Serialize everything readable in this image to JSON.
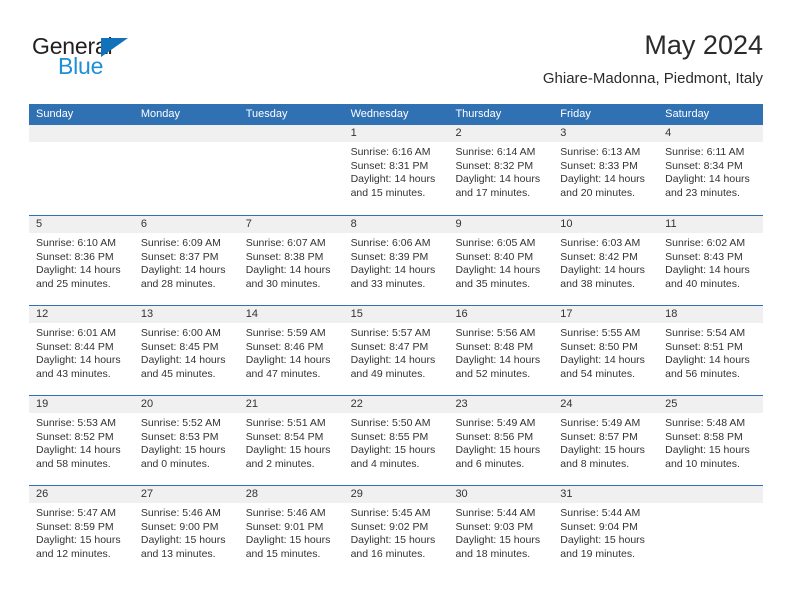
{
  "brand": {
    "name_part1": "General",
    "name_part2": "Blue",
    "triangle_color": "#1271bb",
    "blue_color": "#1f8fd6"
  },
  "header": {
    "month_title": "May 2024",
    "location": "Ghiare-Madonna, Piedmont, Italy"
  },
  "theme": {
    "header_blue": "#3071b4",
    "day_band_gray": "#f0f0f0",
    "text_color": "#333333"
  },
  "weekday_headers": [
    "Sunday",
    "Monday",
    "Tuesday",
    "Wednesday",
    "Thursday",
    "Friday",
    "Saturday"
  ],
  "weeks": [
    [
      {
        "day": "",
        "lines": []
      },
      {
        "day": "",
        "lines": []
      },
      {
        "day": "",
        "lines": []
      },
      {
        "day": "1",
        "lines": [
          "Sunrise: 6:16 AM",
          "Sunset: 8:31 PM",
          "Daylight: 14 hours",
          "and 15 minutes."
        ]
      },
      {
        "day": "2",
        "lines": [
          "Sunrise: 6:14 AM",
          "Sunset: 8:32 PM",
          "Daylight: 14 hours",
          "and 17 minutes."
        ]
      },
      {
        "day": "3",
        "lines": [
          "Sunrise: 6:13 AM",
          "Sunset: 8:33 PM",
          "Daylight: 14 hours",
          "and 20 minutes."
        ]
      },
      {
        "day": "4",
        "lines": [
          "Sunrise: 6:11 AM",
          "Sunset: 8:34 PM",
          "Daylight: 14 hours",
          "and 23 minutes."
        ]
      }
    ],
    [
      {
        "day": "5",
        "lines": [
          "Sunrise: 6:10 AM",
          "Sunset: 8:36 PM",
          "Daylight: 14 hours",
          "and 25 minutes."
        ]
      },
      {
        "day": "6",
        "lines": [
          "Sunrise: 6:09 AM",
          "Sunset: 8:37 PM",
          "Daylight: 14 hours",
          "and 28 minutes."
        ]
      },
      {
        "day": "7",
        "lines": [
          "Sunrise: 6:07 AM",
          "Sunset: 8:38 PM",
          "Daylight: 14 hours",
          "and 30 minutes."
        ]
      },
      {
        "day": "8",
        "lines": [
          "Sunrise: 6:06 AM",
          "Sunset: 8:39 PM",
          "Daylight: 14 hours",
          "and 33 minutes."
        ]
      },
      {
        "day": "9",
        "lines": [
          "Sunrise: 6:05 AM",
          "Sunset: 8:40 PM",
          "Daylight: 14 hours",
          "and 35 minutes."
        ]
      },
      {
        "day": "10",
        "lines": [
          "Sunrise: 6:03 AM",
          "Sunset: 8:42 PM",
          "Daylight: 14 hours",
          "and 38 minutes."
        ]
      },
      {
        "day": "11",
        "lines": [
          "Sunrise: 6:02 AM",
          "Sunset: 8:43 PM",
          "Daylight: 14 hours",
          "and 40 minutes."
        ]
      }
    ],
    [
      {
        "day": "12",
        "lines": [
          "Sunrise: 6:01 AM",
          "Sunset: 8:44 PM",
          "Daylight: 14 hours",
          "and 43 minutes."
        ]
      },
      {
        "day": "13",
        "lines": [
          "Sunrise: 6:00 AM",
          "Sunset: 8:45 PM",
          "Daylight: 14 hours",
          "and 45 minutes."
        ]
      },
      {
        "day": "14",
        "lines": [
          "Sunrise: 5:59 AM",
          "Sunset: 8:46 PM",
          "Daylight: 14 hours",
          "and 47 minutes."
        ]
      },
      {
        "day": "15",
        "lines": [
          "Sunrise: 5:57 AM",
          "Sunset: 8:47 PM",
          "Daylight: 14 hours",
          "and 49 minutes."
        ]
      },
      {
        "day": "16",
        "lines": [
          "Sunrise: 5:56 AM",
          "Sunset: 8:48 PM",
          "Daylight: 14 hours",
          "and 52 minutes."
        ]
      },
      {
        "day": "17",
        "lines": [
          "Sunrise: 5:55 AM",
          "Sunset: 8:50 PM",
          "Daylight: 14 hours",
          "and 54 minutes."
        ]
      },
      {
        "day": "18",
        "lines": [
          "Sunrise: 5:54 AM",
          "Sunset: 8:51 PM",
          "Daylight: 14 hours",
          "and 56 minutes."
        ]
      }
    ],
    [
      {
        "day": "19",
        "lines": [
          "Sunrise: 5:53 AM",
          "Sunset: 8:52 PM",
          "Daylight: 14 hours",
          "and 58 minutes."
        ]
      },
      {
        "day": "20",
        "lines": [
          "Sunrise: 5:52 AM",
          "Sunset: 8:53 PM",
          "Daylight: 15 hours",
          "and 0 minutes."
        ]
      },
      {
        "day": "21",
        "lines": [
          "Sunrise: 5:51 AM",
          "Sunset: 8:54 PM",
          "Daylight: 15 hours",
          "and 2 minutes."
        ]
      },
      {
        "day": "22",
        "lines": [
          "Sunrise: 5:50 AM",
          "Sunset: 8:55 PM",
          "Daylight: 15 hours",
          "and 4 minutes."
        ]
      },
      {
        "day": "23",
        "lines": [
          "Sunrise: 5:49 AM",
          "Sunset: 8:56 PM",
          "Daylight: 15 hours",
          "and 6 minutes."
        ]
      },
      {
        "day": "24",
        "lines": [
          "Sunrise: 5:49 AM",
          "Sunset: 8:57 PM",
          "Daylight: 15 hours",
          "and 8 minutes."
        ]
      },
      {
        "day": "25",
        "lines": [
          "Sunrise: 5:48 AM",
          "Sunset: 8:58 PM",
          "Daylight: 15 hours",
          "and 10 minutes."
        ]
      }
    ],
    [
      {
        "day": "26",
        "lines": [
          "Sunrise: 5:47 AM",
          "Sunset: 8:59 PM",
          "Daylight: 15 hours",
          "and 12 minutes."
        ]
      },
      {
        "day": "27",
        "lines": [
          "Sunrise: 5:46 AM",
          "Sunset: 9:00 PM",
          "Daylight: 15 hours",
          "and 13 minutes."
        ]
      },
      {
        "day": "28",
        "lines": [
          "Sunrise: 5:46 AM",
          "Sunset: 9:01 PM",
          "Daylight: 15 hours",
          "and 15 minutes."
        ]
      },
      {
        "day": "29",
        "lines": [
          "Sunrise: 5:45 AM",
          "Sunset: 9:02 PM",
          "Daylight: 15 hours",
          "and 16 minutes."
        ]
      },
      {
        "day": "30",
        "lines": [
          "Sunrise: 5:44 AM",
          "Sunset: 9:03 PM",
          "Daylight: 15 hours",
          "and 18 minutes."
        ]
      },
      {
        "day": "31",
        "lines": [
          "Sunrise: 5:44 AM",
          "Sunset: 9:04 PM",
          "Daylight: 15 hours",
          "and 19 minutes."
        ]
      },
      {
        "day": "",
        "lines": []
      }
    ]
  ]
}
